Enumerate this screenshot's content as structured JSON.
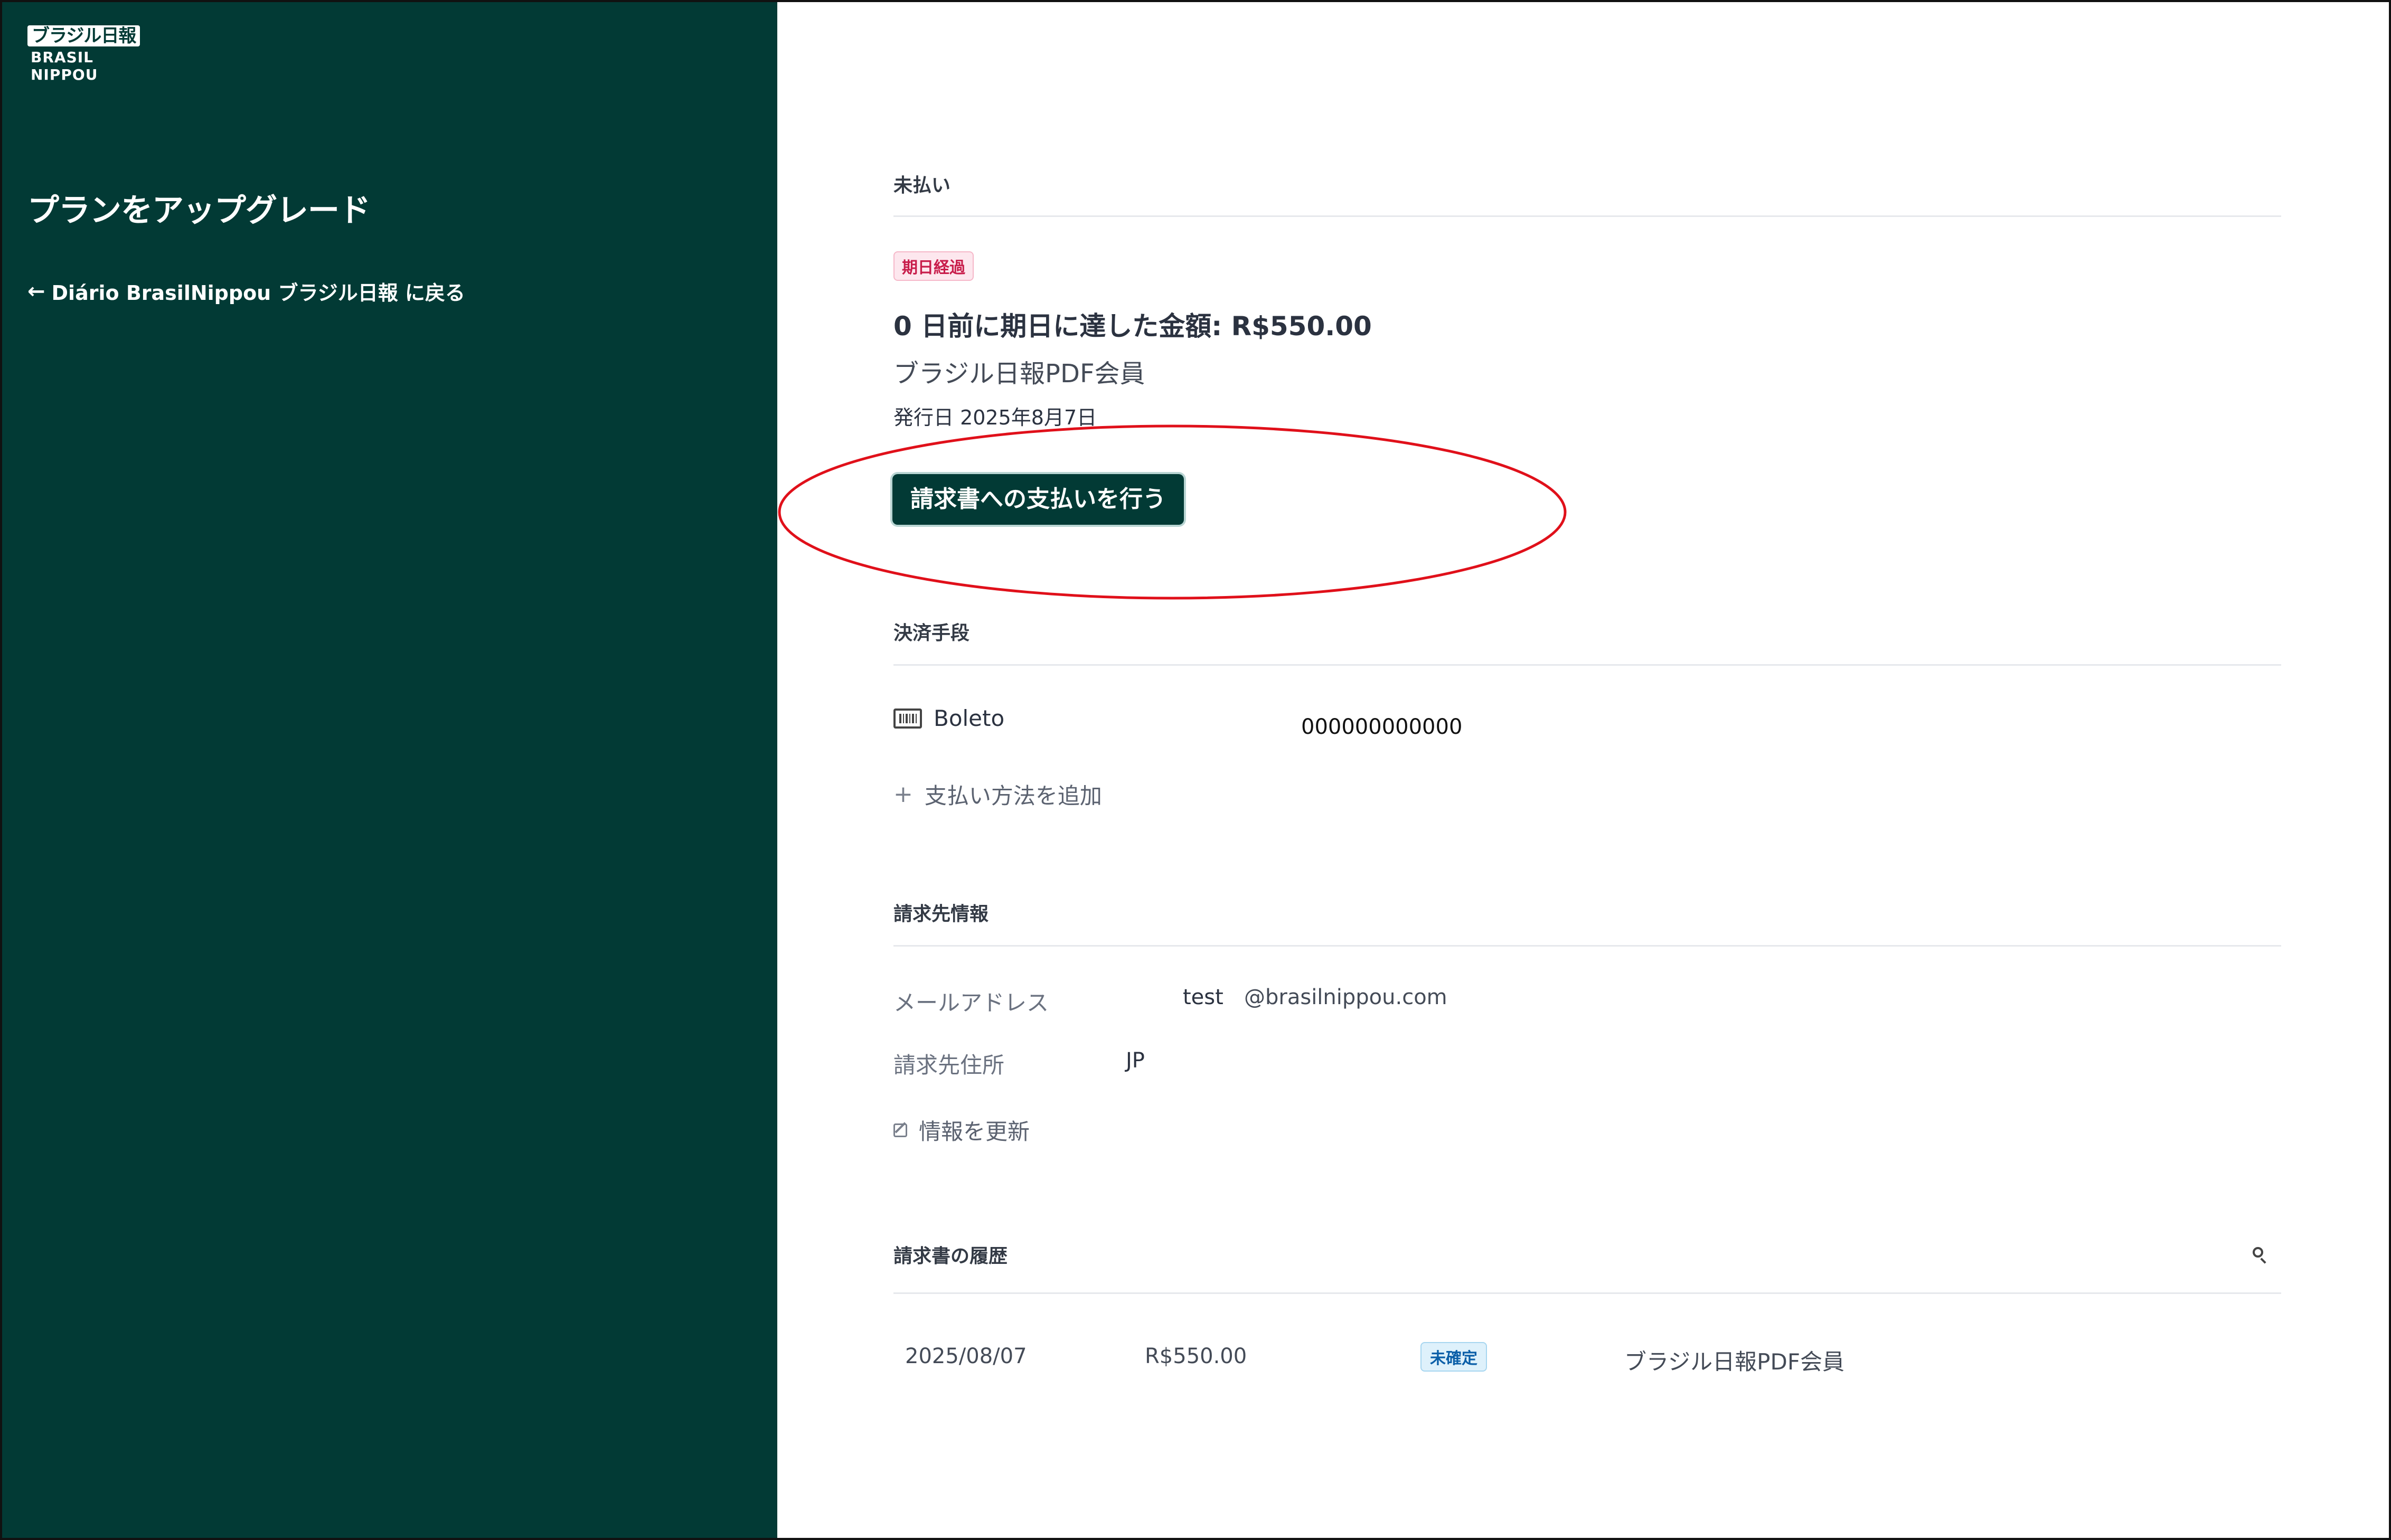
{
  "sidebar": {
    "logo": {
      "japanese": "ブラジル日報",
      "english": "BRASIL NIPPOU"
    },
    "title": "プランをアップグレード",
    "back_link": "Diário BrasilNippou ブラジル日報 に戻る"
  },
  "unpaid": {
    "section_title": "未払い",
    "overdue_badge": "期日経過",
    "amount_text": "0 日前に期日に達した金額: R$550.00",
    "product_name": "ブラジル日報PDF会員",
    "issue_date": "発行日 2025年8月7日",
    "pay_button": "請求書への支払いを行う"
  },
  "payment_methods": {
    "section_title": "決済手段",
    "method_name": "Boleto",
    "method_number": "000000000000",
    "add_link": "支払い方法を追加"
  },
  "billing": {
    "section_title": "請求先情報",
    "email_label": "メールアドレス",
    "email_user": "test",
    "email_domain": "@brasilnippou.com",
    "address_label": "請求先住所",
    "address_value": "JP",
    "update_link": "情報を更新"
  },
  "history": {
    "section_title": "請求書の履歴",
    "rows": [
      {
        "date": "2025/08/07",
        "amount": "R$550.00",
        "status": "未確定",
        "description": "ブラジル日報PDF会員"
      }
    ]
  },
  "colors": {
    "sidebar_bg": "#023a35",
    "button_bg": "#023a35",
    "annotation": "#e0101a",
    "overdue_badge": "#c81d4b",
    "status_badge": "#0b5fa8"
  },
  "icons": {
    "back": "arrow-left-icon",
    "payment_method": "barcode-icon",
    "add": "plus-icon",
    "edit": "edit-icon",
    "search": "search-icon"
  }
}
